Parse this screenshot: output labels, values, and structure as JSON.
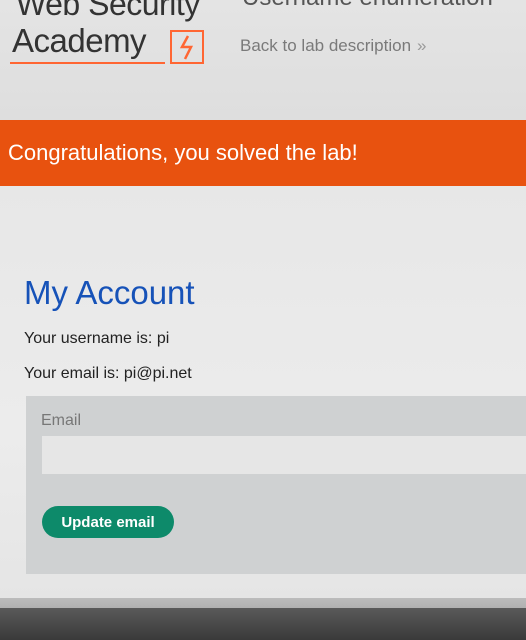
{
  "header": {
    "logo_line1": "Web Security",
    "logo_line2": "Academy",
    "lab_title": "Username enumeration",
    "back_link": "Back to lab description",
    "back_chevron": "»"
  },
  "banner": {
    "text": "Congratulations, you solved the lab!"
  },
  "account": {
    "title": "My Account",
    "username_line": "Your username is: pi",
    "email_line": "Your email is: pi@pi.net"
  },
  "form": {
    "email_label": "Email",
    "email_value": "",
    "submit_label": "Update email"
  },
  "colors": {
    "accent": "#ff6633",
    "banner": "#e8520f",
    "title": "#1652b8",
    "button": "#0d8a6a"
  }
}
